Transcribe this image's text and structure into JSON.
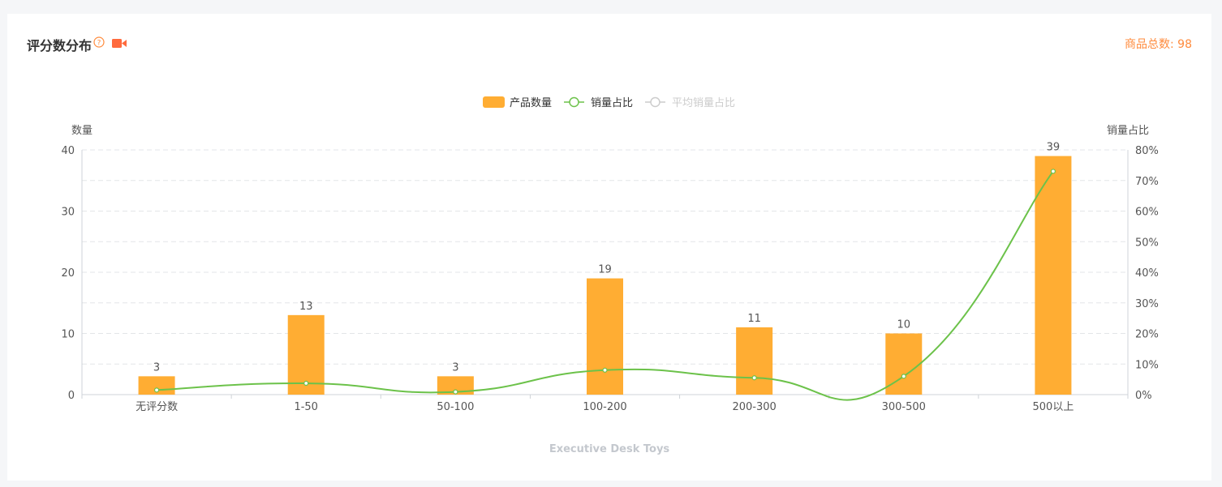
{
  "header": {
    "title": "评分数分布",
    "total_label": "商品总数: ",
    "total_value": "98",
    "help_icon": "question-circle-icon",
    "video_icon": "video-camera-icon"
  },
  "colors": {
    "bar": "#ffad33",
    "line": "#6cc24a",
    "avg_line": "#cccccc",
    "accent": "#ff8b3d"
  },
  "footer": {
    "label": "Executive Desk Toys"
  },
  "chart_data": {
    "type": "bar",
    "categories": [
      "无评分数",
      "1-50",
      "50-100",
      "100-200",
      "200-300",
      "300-500",
      "500以上"
    ],
    "series": [
      {
        "name": "产品数量",
        "type": "bar",
        "axis": "left",
        "values": [
          3,
          13,
          3,
          19,
          11,
          10,
          39
        ],
        "labels": [
          "3",
          "13",
          "3",
          "19",
          "11",
          "10",
          "39"
        ]
      },
      {
        "name": "销量占比",
        "type": "line",
        "axis": "right",
        "values": [
          1.5,
          3.7,
          0.9,
          8,
          5.5,
          6,
          73
        ]
      },
      {
        "name": "平均销量占比",
        "type": "line",
        "axis": "right",
        "values": [],
        "disabled": true
      }
    ],
    "ylabel_left": "数量",
    "ylabel_right": "销量占比",
    "ylim_left": [
      0,
      40
    ],
    "ylim_right": [
      0,
      80
    ],
    "yticks_left": [
      "0",
      "10",
      "20",
      "30",
      "40"
    ],
    "yticks_right": [
      "0%",
      "10%",
      "20%",
      "30%",
      "40%",
      "50%",
      "60%",
      "70%",
      "80%"
    ],
    "legend_position": "top-center",
    "grid": true
  }
}
